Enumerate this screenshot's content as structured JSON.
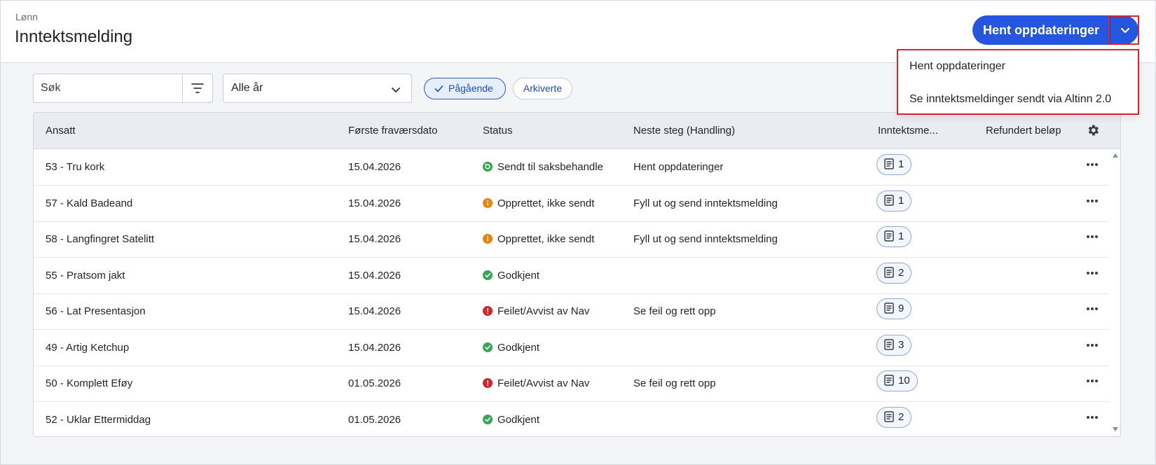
{
  "header": {
    "breadcrumb": "Lønn",
    "title": "Inntektsmelding",
    "primary_button": "Hent oppdateringer",
    "split_icon": "chevron-down-icon"
  },
  "menu": {
    "items": [
      "Hent oppdateringer",
      "Se inntektsmeldinger sendt via Altinn 2.0"
    ]
  },
  "toolbar": {
    "search_placeholder": "Søk",
    "filter_icon": "filter-icon",
    "year_select": "Alle år",
    "chips": [
      "Pågående",
      "Arkiverte"
    ]
  },
  "table": {
    "columns": [
      "Ansatt",
      "Første fraværsdato",
      "Status",
      "Neste steg (Handling)",
      "Inntektsme...",
      "Refundert beløp"
    ],
    "rows": [
      {
        "employee": "53 - Tru kork",
        "date": "15.04.2026",
        "status": "Sendt til saksbehandle",
        "status_type": "sent",
        "next_step": "Hent oppdateringer",
        "count": "1"
      },
      {
        "employee": "57 - Kald Badeand",
        "date": "15.04.2026",
        "status": "Opprettet, ikke sendt",
        "status_type": "warning",
        "next_step": "Fyll ut og send inntektsmelding",
        "count": "1"
      },
      {
        "employee": "58 - Langfingret Satelitt",
        "date": "15.04.2026",
        "status": "Opprettet, ikke sendt",
        "status_type": "warning",
        "next_step": "Fyll ut og send inntektsmelding",
        "count": "1"
      },
      {
        "employee": "55 - Pratsom jakt",
        "date": "15.04.2026",
        "status": "Godkjent",
        "status_type": "approved",
        "next_step": "",
        "count": "2"
      },
      {
        "employee": "56 - Lat Presentasjon",
        "date": "15.04.2026",
        "status": "Feilet/Avvist av Nav",
        "status_type": "error",
        "next_step": "Se feil og rett opp",
        "count": "9"
      },
      {
        "employee": "49 - Artig Ketchup",
        "date": "15.04.2026",
        "status": "Godkjent",
        "status_type": "approved",
        "next_step": "",
        "count": "3"
      },
      {
        "employee": "50 - Komplett Eføy",
        "date": "01.05.2026",
        "status": "Feilet/Avvist av Nav",
        "status_type": "error",
        "next_step": "Se feil og rett opp",
        "count": "10"
      },
      {
        "employee": "52 - Uklar Ettermiddag",
        "date": "01.05.2026",
        "status": "Godkjent",
        "status_type": "approved",
        "next_step": "",
        "count": "2"
      }
    ]
  },
  "colors": {
    "primary": "#2456e0",
    "highlight": "#d9232e",
    "status_sent": "#2fa84f",
    "status_warning": "#e8850e",
    "status_error": "#d3262b",
    "status_approved": "#3aa55a"
  }
}
